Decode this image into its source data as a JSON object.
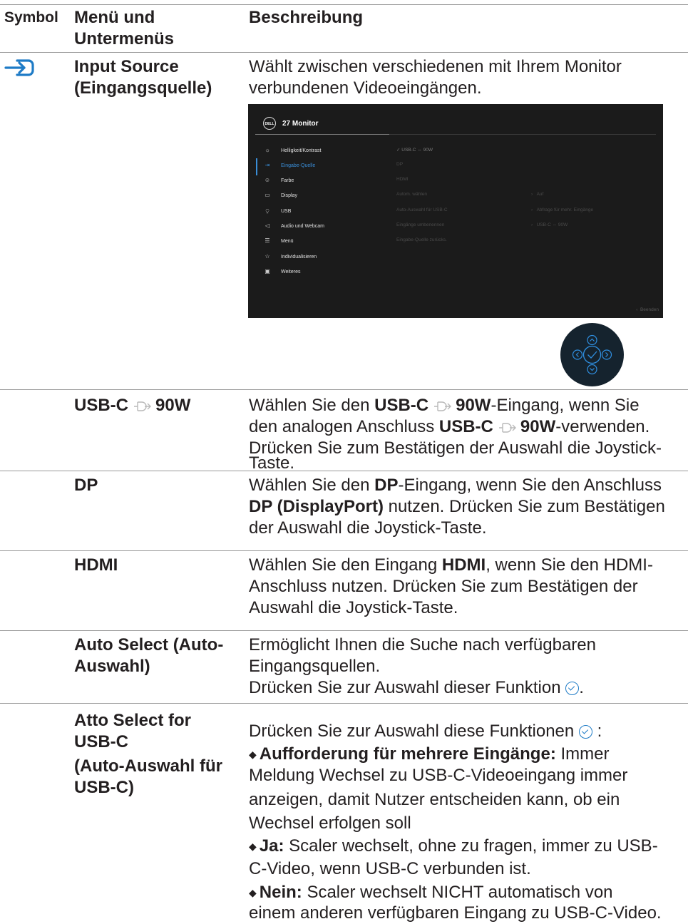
{
  "header": {
    "symbol": "Symbol",
    "menu": "Menü und Untermenüs",
    "menu_line1": "Menü und",
    "menu_line2": "Untermenüs",
    "description": "Beschreibung"
  },
  "input_source": {
    "icon": "input-source-icon",
    "name_line1": "Input Source",
    "name_line2": "(Eingangsquelle)",
    "desc_line1": "Wählt zwischen verschiedenen mit Ihrem Monitor",
    "desc_line2": "verbundenen Videoeingängen."
  },
  "osd": {
    "logo": "DELL",
    "title": "27 Monitor",
    "menu_items": [
      {
        "icon": "brightness-icon",
        "label": "Helligkeit/Kontrast"
      },
      {
        "icon": "input-icon",
        "label": "Eingabe-Quelle",
        "selected": true
      },
      {
        "icon": "palette-icon",
        "label": "Farbe"
      },
      {
        "icon": "display-icon",
        "label": "Display"
      },
      {
        "icon": "usb-icon",
        "label": "USB"
      },
      {
        "icon": "audio-icon",
        "label": "Audio und Webcam"
      },
      {
        "icon": "menu-icon",
        "label": "Menü"
      },
      {
        "icon": "star-icon",
        "label": "Individualisieren"
      },
      {
        "icon": "others-icon",
        "label": "Weiteres"
      }
    ],
    "submenu": [
      {
        "label": "USB-C ⇔ 90W",
        "checked": true
      },
      {
        "label": "DP"
      },
      {
        "label": "HDMI"
      },
      {
        "label": "Autom. wählen",
        "value": "Auf"
      },
      {
        "label": "Auto-Auswahl für USB-C",
        "value": "Abfrage für mehr. Eingänge"
      },
      {
        "label": "Eingänge umbenennen",
        "value": "USB-C ⇔ 90W"
      },
      {
        "label": "Eingabe-Quelle zurücks."
      }
    ],
    "exit": "Beenden"
  },
  "rows": {
    "usbc": {
      "name_a": "USB-C",
      "name_b": "90W",
      "l1_a": "Wählen Sie den ",
      "l1_b": "USB-C",
      "l1_c": "90W",
      "l1_d": "-Eingang, wenn Sie",
      "l2_a": "den analogen Anschluss ",
      "l2_b": "USB-C",
      "l2_c": "90W",
      "l2_d": "-verwenden.",
      "l3": "Drücken Sie zum Bestätigen der Auswahl die Joystick-",
      "l4": "Taste."
    },
    "dp": {
      "name": "DP",
      "l1_a": "Wählen Sie den ",
      "l1_b": "DP",
      "l1_c": "-Eingang, wenn Sie den Anschluss",
      "l2_a": "DP (DisplayPort)",
      "l2_b": " nutzen. Drücken Sie zum Bestätigen",
      "l3": "der Auswahl die Joystick-Taste."
    },
    "hdmi": {
      "name": "HDMI",
      "l1_a": "Wählen Sie den Eingang ",
      "l1_b": "HDMI",
      "l1_c": ", wenn Sie den HDMI-",
      "l2": "Anschluss nutzen. Drücken Sie zum Bestätigen der",
      "l3": "Auswahl die Joystick-Taste."
    },
    "auto": {
      "name_line1": "Auto Select (Auto-",
      "name_line2": "Auswahl)",
      "l1": "Ermöglicht Ihnen die Suche nach verfügbaren",
      "l2": "Eingangsquellen.",
      "l3": "Drücken Sie zur Auswahl dieser Funktion",
      "l3_end": "."
    },
    "atto": {
      "name_line1": "Atto Select for",
      "name_line2": "USB-C",
      "name_line3": "(Auto-Auswahl für",
      "name_line4": "USB-C)",
      "intro": "Drücken Sie zur Auswahl diese Funktionen",
      "intro_end": " :",
      "b1_bold": "Aufforderung für mehrere Eingänge:",
      "b1_l1_rest": " Immer",
      "b1_l2": "Meldung Wechsel zu USB-C-Videoeingang immer",
      "b1_l3": "anzeigen, damit Nutzer entscheiden kann, ob ein",
      "b1_l4": "Wechsel erfolgen soll",
      "b2_bold": "Ja:",
      "b2_l1_rest": " Scaler wechselt, ohne zu fragen, immer zu USB-",
      "b2_l2": "C-Video, wenn USB-C verbunden ist.",
      "b3_bold": "Nein:",
      "b3_l1_rest": " Scaler wechselt NICHT automatisch von",
      "b3_l2": "einem anderen verfügbaren Eingang zu USB-C-Video."
    }
  }
}
